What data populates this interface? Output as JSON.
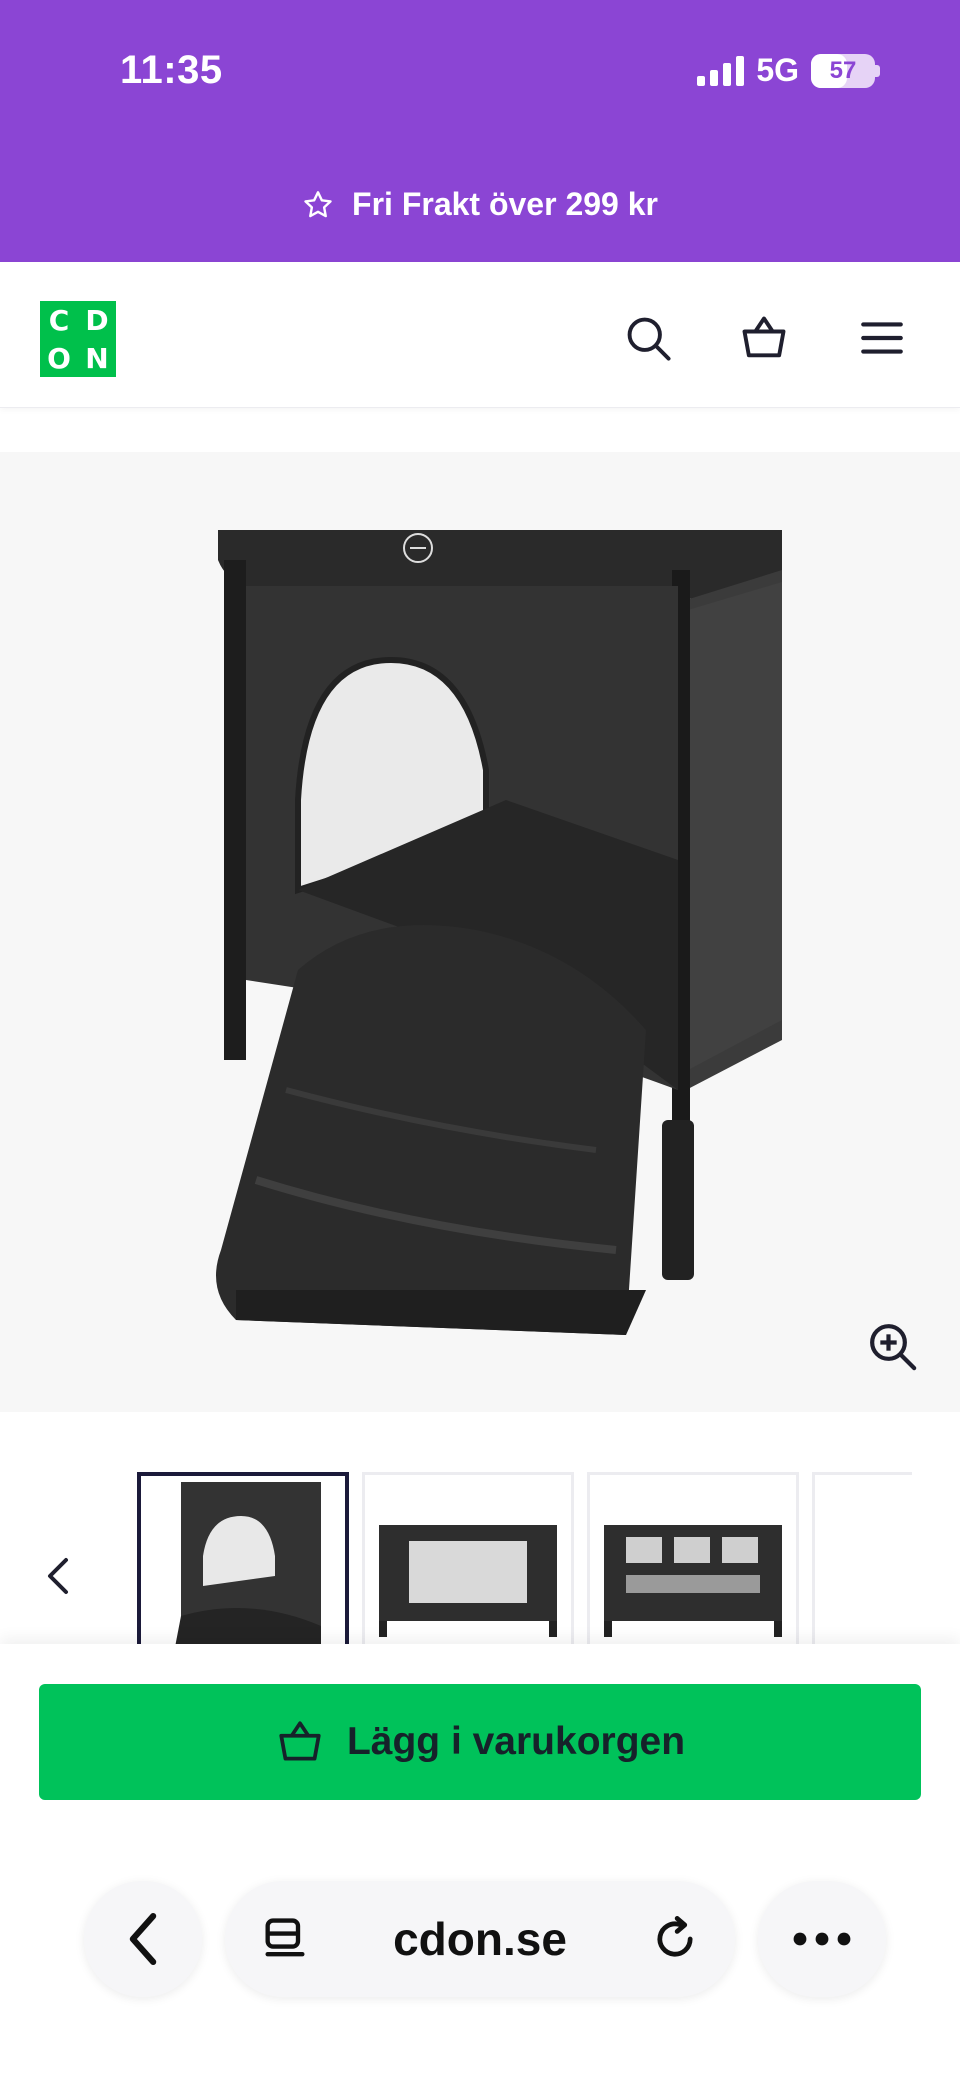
{
  "status_bar": {
    "time": "11:35",
    "network": "5G",
    "battery": "57",
    "battery_level": 0.57
  },
  "promo": {
    "text": "Fri Frakt över 299 kr",
    "icon": "star-outline-icon"
  },
  "header": {
    "logo": "CDON",
    "icons": [
      "search-icon",
      "basket-icon",
      "hamburger-menu-icon"
    ]
  },
  "gallery": {
    "main_image": "black-travel-cot-with-open-flap-door",
    "zoom_icon": "zoom-in-icon",
    "thumbnails": [
      {
        "name": "travel-cot-open-flap",
        "selected": true
      },
      {
        "name": "travel-cot-side-mesh",
        "selected": false
      },
      {
        "name": "travel-cot-mesh-panels",
        "selected": false
      }
    ],
    "prev_icon": "chevron-left-icon",
    "next_icon": "chevron-right-icon"
  },
  "cart": {
    "button_label": "Lägg i varukorgen",
    "icon": "basket-icon"
  },
  "browser": {
    "url": "cdon.se",
    "back_icon": "chevron-left-icon",
    "tabs_icon": "reader-icon",
    "reload_icon": "reload-icon",
    "more_icon": "more-dots-icon"
  },
  "colors": {
    "brand_purple": "#8b45d4",
    "brand_green": "#00c04b",
    "cta_green": "#00c25a"
  }
}
